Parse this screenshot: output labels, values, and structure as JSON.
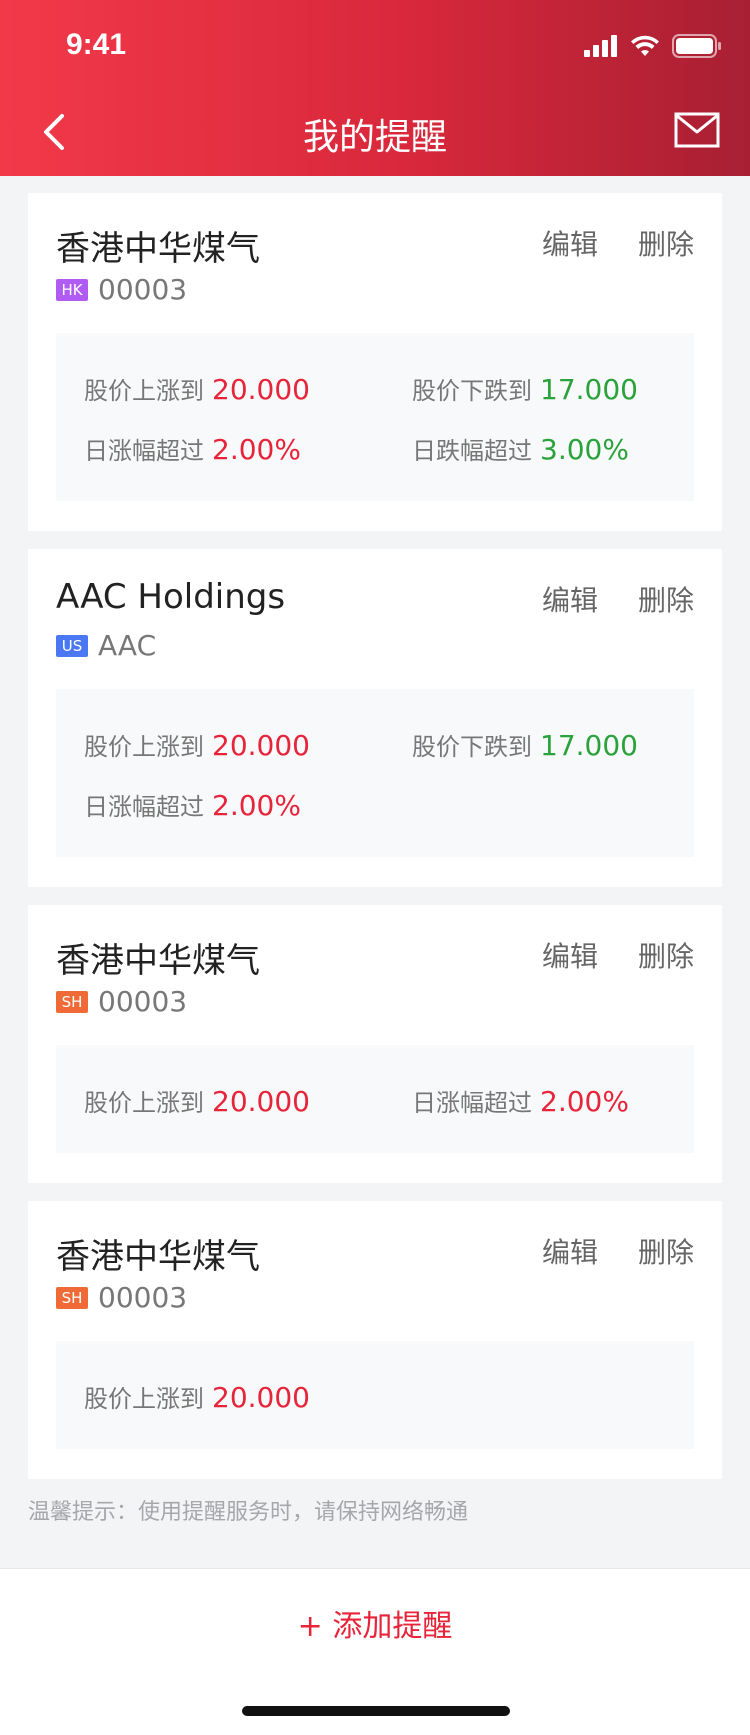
{
  "status_bar": {
    "time": "9:41"
  },
  "header": {
    "title": "我的提醒"
  },
  "colors": {
    "up": "#e8243a",
    "down": "#2ba23b",
    "header_start": "#f2394a",
    "header_end": "#a81f33"
  },
  "actions": {
    "edit": "编辑",
    "delete": "删除"
  },
  "cards": [
    {
      "name": "香港中华煤气",
      "market": "HK",
      "code": "00003",
      "conditions": [
        {
          "label": "股价上涨到",
          "value": "20.000"
        },
        {
          "label": "股价下跌到",
          "value": "17.000"
        },
        {
          "label": "日涨幅超过",
          "value": "2.00%"
        },
        {
          "label": "日跌幅超过",
          "value": "3.00%"
        }
      ]
    },
    {
      "name": "AAC Holdings",
      "market": "US",
      "code": "AAC",
      "conditions": [
        {
          "label": "股价上涨到",
          "value": "20.000"
        },
        {
          "label": "股价下跌到",
          "value": "17.000"
        },
        {
          "label": "日涨幅超过",
          "value": "2.00%"
        }
      ]
    },
    {
      "name": "香港中华煤气",
      "market": "SH",
      "code": "00003",
      "conditions": [
        {
          "label": "股价上涨到",
          "value": "20.000"
        },
        {
          "label": "日涨幅超过",
          "value": "2.00%"
        }
      ]
    },
    {
      "name": "香港中华煤气",
      "market": "SH",
      "code": "00003",
      "conditions": [
        {
          "label": "股价上涨到",
          "value": "20.000"
        }
      ]
    }
  ],
  "tip": "温馨提示：使用提醒服务时，请保持网络畅通",
  "add_button": {
    "icon": "+",
    "label": "添加提醒"
  }
}
